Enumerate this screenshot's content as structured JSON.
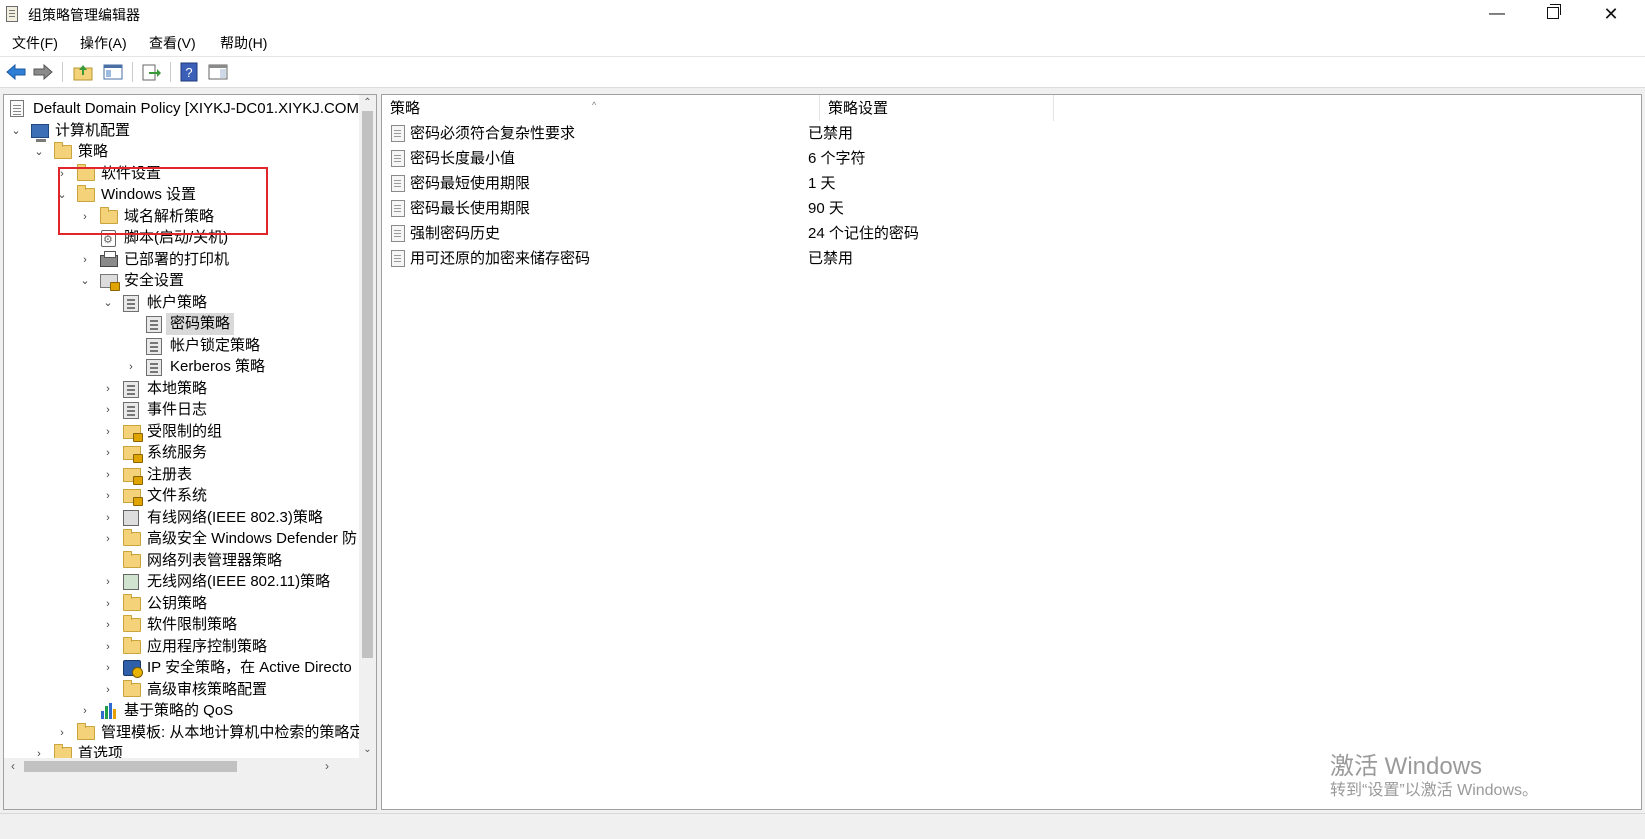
{
  "window": {
    "title": "组策略管理编辑器",
    "min_glyph": "—",
    "close_glyph": "✕"
  },
  "menu": [
    "文件(F)",
    "操作(A)",
    "查看(V)",
    "帮助(H)"
  ],
  "tree": {
    "root": "Default Domain Policy [XIYKJ-DC01.XIYKJ.COM",
    "items": [
      {
        "label": "计算机配置"
      },
      {
        "label": "策略"
      },
      {
        "label": "软件设置"
      },
      {
        "label": "Windows 设置"
      },
      {
        "label": "域名解析策略"
      },
      {
        "label": "脚本(启动/关机)"
      },
      {
        "label": "已部署的打印机"
      },
      {
        "label": "安全设置"
      },
      {
        "label": "帐户策略"
      },
      {
        "label": "密码策略",
        "selected": true
      },
      {
        "label": "帐户锁定策略"
      },
      {
        "label": "Kerberos 策略"
      },
      {
        "label": "本地策略"
      },
      {
        "label": "事件日志"
      },
      {
        "label": "受限制的组"
      },
      {
        "label": "系统服务"
      },
      {
        "label": "注册表"
      },
      {
        "label": "文件系统"
      },
      {
        "label": "有线网络(IEEE 802.3)策略"
      },
      {
        "label": "高级安全 Windows Defender 防"
      },
      {
        "label": "网络列表管理器策略"
      },
      {
        "label": "无线网络(IEEE 802.11)策略"
      },
      {
        "label": "公钥策略"
      },
      {
        "label": "软件限制策略"
      },
      {
        "label": "应用程序控制策略"
      },
      {
        "label": "IP 安全策略，在 Active Directo"
      },
      {
        "label": "高级审核策略配置"
      },
      {
        "label": "基于策略的 QoS"
      },
      {
        "label": "管理模板: 从本地计算机中检索的策略定"
      },
      {
        "label": "首选项"
      }
    ]
  },
  "list": {
    "columns": [
      "策略",
      "策略设置"
    ],
    "rows": [
      {
        "name": "密码必须符合复杂性要求",
        "value": "已禁用"
      },
      {
        "name": "密码长度最小值",
        "value": "6 个字符"
      },
      {
        "name": "密码最短使用期限",
        "value": "1 天"
      },
      {
        "name": "密码最长使用期限",
        "value": "90 天"
      },
      {
        "name": "强制密码历史",
        "value": "24 个记住的密码"
      },
      {
        "name": "用可还原的加密来储存密码",
        "value": "已禁用"
      }
    ]
  },
  "watermark": {
    "title": "激活 Windows",
    "subtitle": "转到“设置”以激活 Windows。"
  },
  "colors": {
    "highlight_box": "#e0262b",
    "back_arrow": "#2f7fd6"
  }
}
